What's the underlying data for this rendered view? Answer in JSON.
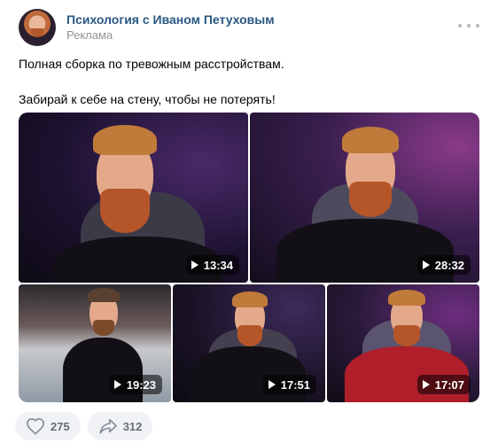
{
  "post": {
    "author": "Психология с Иваном Петуховым",
    "label": "Реклама",
    "text_lines": [
      "Полная сборка по тревожным расстройствам.",
      "Забирай к себе на стену, чтобы не потерять!"
    ]
  },
  "videos": [
    {
      "duration": "13:34"
    },
    {
      "duration": "28:32"
    },
    {
      "duration": "19:23"
    },
    {
      "duration": "17:51"
    },
    {
      "duration": "17:07"
    }
  ],
  "actions": {
    "likes": "275",
    "shares": "312"
  },
  "icons": {
    "like": "heart-icon",
    "share": "share-icon",
    "more": "more-dots-icon",
    "play": "play-icon"
  },
  "colors": {
    "link": "#2a5885",
    "muted": "#939393",
    "action_bg": "#f0f2f5"
  }
}
